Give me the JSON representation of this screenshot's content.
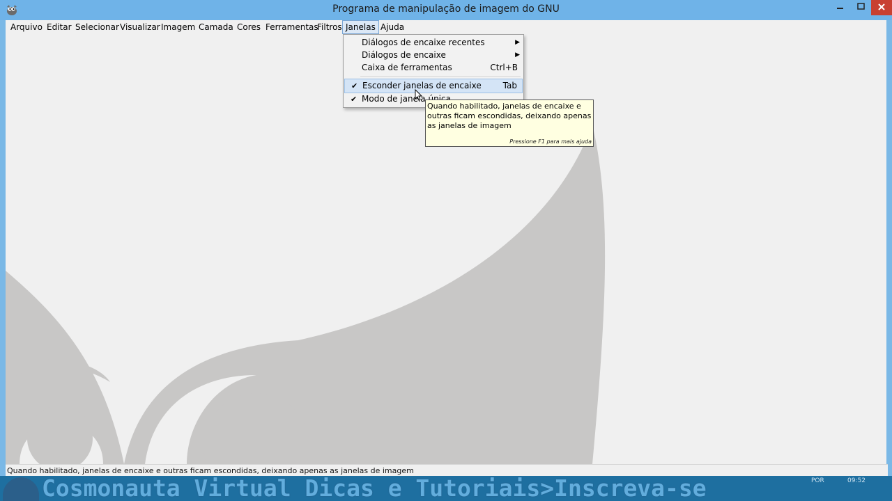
{
  "window": {
    "title": "Programa de manipulação de imagem do GNU",
    "icons": {
      "app": "gimp-wilber-icon",
      "minimize": "minimize-icon",
      "maximize": "maximize-icon",
      "close": "close-icon"
    },
    "close_color": "#c84031"
  },
  "menubar": {
    "items": [
      "Arquivo",
      "Editar",
      "Selecionar",
      "Visualizar",
      "Imagem",
      "Camada",
      "Cores",
      "Ferramentas",
      "Filtros",
      "Janelas",
      "Ajuda"
    ],
    "active": "Janelas"
  },
  "dropdown": {
    "items": [
      {
        "label": "Diálogos de encaixe recentes",
        "submenu": true
      },
      {
        "label": "Diálogos de encaixe",
        "submenu": true
      },
      {
        "label": "Caixa de ferramentas",
        "accel": "Ctrl+B"
      },
      {
        "label": "Esconder janelas de encaixe",
        "accel": "Tab",
        "checked": true,
        "highlighted": true
      },
      {
        "label": "Modo de janela única",
        "checked": true
      }
    ]
  },
  "tooltip": {
    "text": "Quando habilitado, janelas de encaixe e outras ficam escondidas, deixando apenas as janelas de imagem",
    "help": "Pressione F1 para mais ajuda"
  },
  "statusbar": {
    "text": "Quando habilitado, janelas de encaixe e outras ficam escondidas, deixando apenas as janelas de imagem"
  },
  "taskbar": {
    "banner": "Cosmonauta Virtual Dicas e Tutoriais>Inscreva-se",
    "lang": "POR",
    "time": "09:52"
  },
  "colors": {
    "titlebar": "#6fb3e8",
    "menu_highlight": "#d4e4f6",
    "tooltip_bg": "#ffffe1",
    "watermark": "#c8c7c6"
  }
}
